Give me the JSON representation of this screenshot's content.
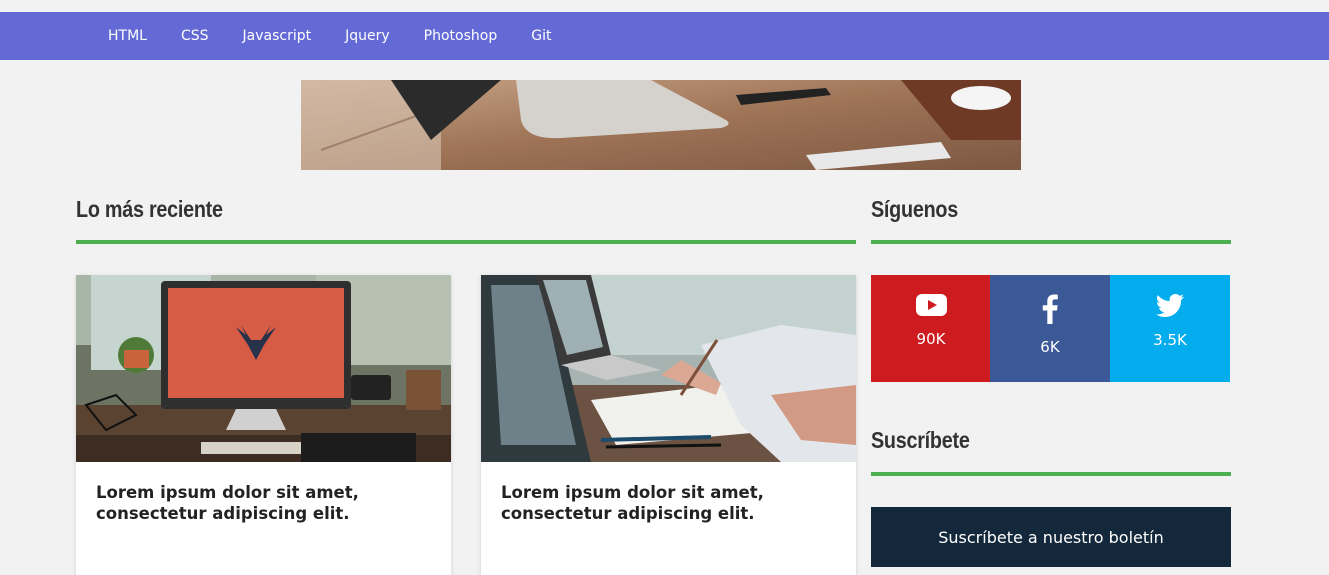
{
  "nav": {
    "items": [
      "HTML",
      "CSS",
      "Javascript",
      "Jquery",
      "Photoshop",
      "Git"
    ]
  },
  "sections": {
    "latest": "Lo más reciente",
    "follow": "Síguenos",
    "subscribe": "Suscríbete"
  },
  "posts": [
    {
      "title": "Lorem ipsum dolor sit amet, consectetur adipiscing elit.",
      "image": "desk-imac-icon"
    },
    {
      "title": "Lorem ipsum dolor sit amet, consectetur adipiscing elit.",
      "image": "laptop-writing-icon"
    }
  ],
  "social": [
    {
      "network": "youtube",
      "icon": "youtube-icon",
      "count": "90K",
      "color": "#cd1b1f"
    },
    {
      "network": "facebook",
      "icon": "facebook-icon",
      "count": "6K",
      "color": "#3b5897"
    },
    {
      "network": "twitter",
      "icon": "twitter-icon",
      "count": "3.5K",
      "color": "#03aced"
    }
  ],
  "newsletter": {
    "label": "Suscríbete a nuestro boletín",
    "background": "#13283a"
  },
  "colors": {
    "nav": "#636ad6",
    "accent_rule": "#4caf50",
    "page": "#f2f2f2"
  }
}
